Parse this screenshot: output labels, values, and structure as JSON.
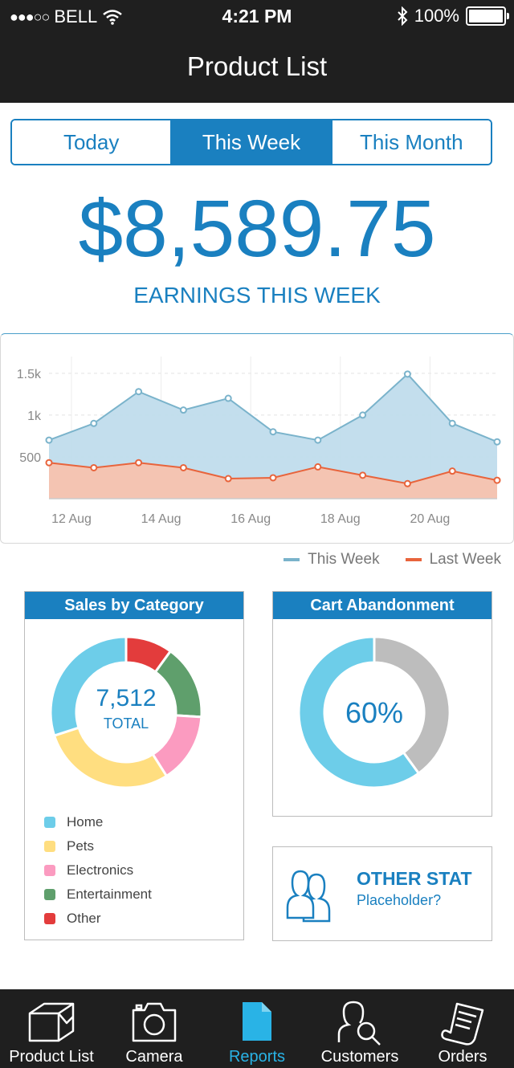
{
  "status_bar": {
    "carrier": "BELL",
    "time": "4:21 PM",
    "battery": "100%"
  },
  "header": {
    "title": "Product List"
  },
  "segments": [
    {
      "label": "Today",
      "active": false
    },
    {
      "label": "This Week",
      "active": true
    },
    {
      "label": "This Month",
      "active": false
    }
  ],
  "earnings": {
    "value": "$8,589.75",
    "label": "EARNINGS THIS WEEK"
  },
  "chart_data": {
    "type": "area",
    "x_tick_labels": [
      "12 Aug",
      "14 Aug",
      "16 Aug",
      "18 Aug",
      "20 Aug"
    ],
    "y_tick_labels": [
      "1.5k",
      "1k",
      "500"
    ],
    "ylim": [
      0,
      1700
    ],
    "grid": true,
    "legend_position": "bottom-right",
    "series": [
      {
        "name": "This Week",
        "color": "#7ab3cb",
        "fill": "#c0dcec",
        "values": [
          700,
          900,
          1280,
          1060,
          1200,
          800,
          700,
          1000,
          1490,
          900,
          680
        ]
      },
      {
        "name": "Last Week",
        "color": "#e8643c",
        "fill": "#f7c2af",
        "values": [
          430,
          370,
          430,
          370,
          240,
          250,
          380,
          280,
          180,
          330,
          220
        ]
      }
    ]
  },
  "sales_panel": {
    "title": "Sales by Category",
    "total": "7,512",
    "total_label": "TOTAL",
    "categories": [
      {
        "name": "Home",
        "color": "#6dcde9",
        "share": 30
      },
      {
        "name": "Pets",
        "color": "#ffde80",
        "share": 29
      },
      {
        "name": "Electronics",
        "color": "#fb9bc0",
        "share": 15
      },
      {
        "name": "Entertainment",
        "color": "#5f9f6c",
        "share": 16
      },
      {
        "name": "Other",
        "color": "#e33c3c",
        "share": 10
      }
    ]
  },
  "cart_panel": {
    "title": "Cart Abandonment",
    "percent_label": "60%",
    "percent": 60,
    "colors": {
      "main": "#6dcde9",
      "rest": "#bdbdbd"
    }
  },
  "stat_panel": {
    "title": "OTHER STAT",
    "subtitle": "Placeholder?",
    "icon": "users-icon"
  },
  "tabbar": [
    {
      "label": "Product List",
      "icon": "box-icon",
      "active": false
    },
    {
      "label": "Camera",
      "icon": "camera-icon",
      "active": false
    },
    {
      "label": "Reports",
      "icon": "document-icon",
      "active": true
    },
    {
      "label": "Customers",
      "icon": "customer-search-icon",
      "active": false
    },
    {
      "label": "Orders",
      "icon": "receipt-icon",
      "active": false
    }
  ],
  "colors": {
    "accent": "#1a80c0",
    "dark": "#1f1f1f",
    "active_tab": "#29b3e6"
  }
}
